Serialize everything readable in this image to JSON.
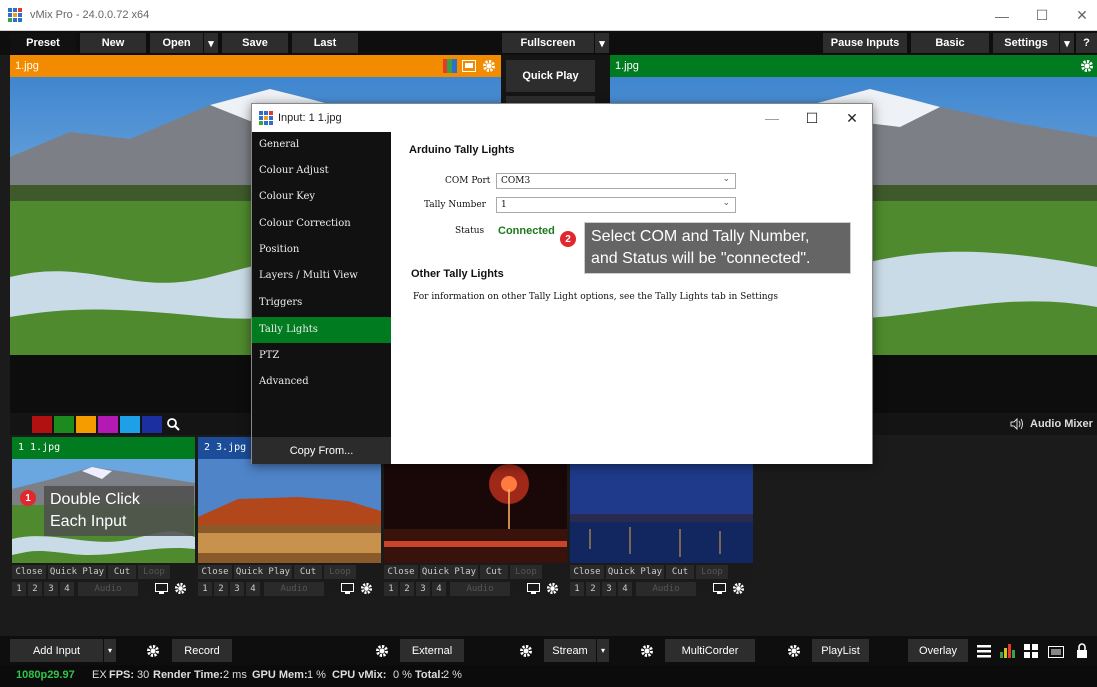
{
  "window": {
    "title": "vMix Pro - 24.0.0.72 x64",
    "min": "—",
    "max": "☐",
    "close": "✕"
  },
  "toolbar": {
    "preset": "Preset",
    "new": "New",
    "open": "Open",
    "save": "Save",
    "last": "Last",
    "fullscreen": "Fullscreen",
    "pause_inputs": "Pause Inputs",
    "basic": "Basic",
    "settings": "Settings",
    "help": "?",
    "caret": "▾"
  },
  "preview": {
    "label": "1.jpg"
  },
  "output": {
    "label": "1.jpg"
  },
  "center": {
    "quick_play": "Quick Play"
  },
  "colors": {
    "swatches": [
      "#b21111",
      "#1c8a1c",
      "#f49c00",
      "#b319b3",
      "#1ea0e8",
      "#1c2fa0"
    ],
    "accent_orange": "#f38b00",
    "accent_green": "#007b1f"
  },
  "audio": {
    "label": "Audio Mixer"
  },
  "inputs": [
    {
      "header": "1  1.jpg"
    },
    {
      "header": "2  3.jpg"
    },
    {
      "header": ""
    },
    {
      "header": ""
    }
  ],
  "input_buttons": {
    "close": "Close",
    "quick_play": "Quick Play",
    "cut": "Cut",
    "loop": "Loop",
    "n1": "1",
    "n2": "2",
    "n3": "3",
    "n4": "4",
    "audio": "Audio"
  },
  "callout1": {
    "badge": "1",
    "line1": "Double Click",
    "line2": "Each Input"
  },
  "dialog": {
    "title": "Input: 1 1.jpg",
    "sidebar": [
      "General",
      "Colour Adjust",
      "Colour Key",
      "Colour Correction",
      "Position",
      "Layers / Multi View",
      "Triggers",
      "Tally Lights",
      "PTZ",
      "Advanced"
    ],
    "copy_from": "Copy From...",
    "section1": "Arduino Tally Lights",
    "com_label": "COM Port",
    "com_value": "COM3",
    "tally_label": "Tally Number",
    "tally_value": "1",
    "status_label": "Status",
    "status_value": "Connected",
    "section2": "Other Tally Lights",
    "info": "For information on other Tally Light options, see the Tally Lights tab in Settings"
  },
  "callout2": {
    "badge": "2",
    "line1": "Select COM and Tally Number,",
    "line2": "and Status will be \"connected\"."
  },
  "bottom": {
    "add_input": "Add Input",
    "record": "Record",
    "external": "External",
    "stream": "Stream",
    "multicorder": "MultiCorder",
    "playlist": "PlayList",
    "overlay": "Overlay"
  },
  "status": {
    "format": "1080p29.97",
    "ex": "EX",
    "fps_label": "FPS:",
    "fps": "30",
    "render_label": "Render Time:",
    "render": "2 ms",
    "gpu_label": "GPU Mem:",
    "gpu": "1 %",
    "cpu_label": "CPU vMix:",
    "cpu": "0 %",
    "total_label": "Total:",
    "total": "2 %"
  }
}
